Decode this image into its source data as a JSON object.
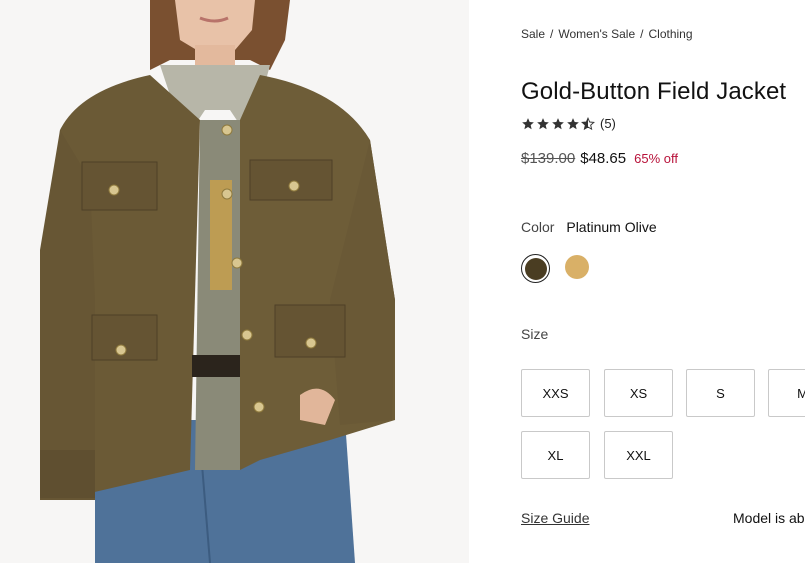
{
  "breadcrumb": {
    "items": [
      "Sale",
      "Women's Sale",
      "Clothing"
    ],
    "separator": "/"
  },
  "product": {
    "title": "Gold-Button Field Jacket",
    "rating": 4.5,
    "review_count": "(5)",
    "price_original": "$139.00",
    "price_sale": "$48.65",
    "discount": "65% off"
  },
  "color": {
    "label": "Color",
    "selected_name": "Platinum Olive",
    "swatches": [
      {
        "name": "Platinum Olive",
        "hex": "#4a3d22",
        "selected": true
      },
      {
        "name": "Tan",
        "hex": "#d9b067",
        "selected": false
      }
    ]
  },
  "size": {
    "label": "Size",
    "options": [
      "XXS",
      "XS",
      "S",
      "M",
      "XL",
      "XXL"
    ]
  },
  "links": {
    "size_guide": "Size Guide",
    "model_info": "Model is ab"
  },
  "colors": {
    "accent_sale": "#b8123a",
    "jacket": "#6b5a36",
    "jeans": "#4c6f96"
  },
  "icons": {
    "star": "star-icon",
    "half_star": "half-star-icon"
  }
}
